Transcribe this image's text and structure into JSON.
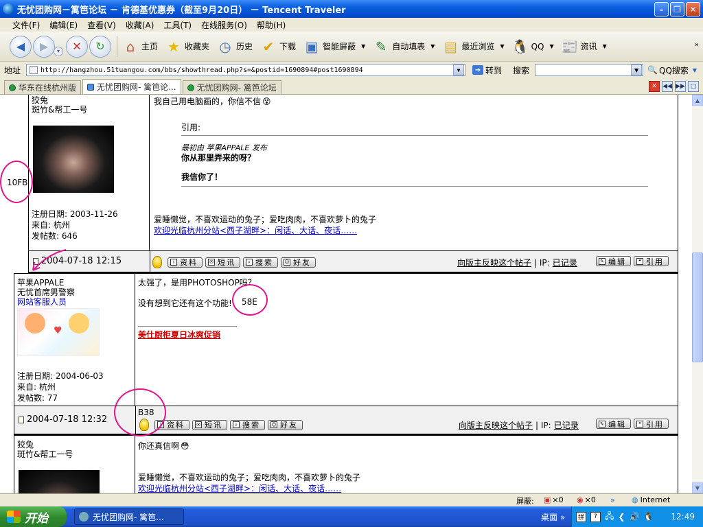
{
  "window": {
    "title": "无忧团购网－篱笆论坛 － 肯德基优惠券（截至9月20日） － Tencent Traveler"
  },
  "menu": [
    "文件(F)",
    "编辑(E)",
    "查看(V)",
    "收藏(A)",
    "工具(T)",
    "在线服务(O)",
    "帮助(H)"
  ],
  "toolbar": {
    "home": "主页",
    "favorites": "收藏夹",
    "history": "历史",
    "download": "下载",
    "block": "智能屏蔽",
    "autofill": "自动填表",
    "recent": "最近浏览",
    "qq": "QQ",
    "news": "资讯"
  },
  "address": {
    "label": "地址",
    "url": "http://hangzhou.51tuangou.com/bbs/showthread.php?s=&postid=1690894#post1690894",
    "go": "转到",
    "search_label": "搜索",
    "search_value": "",
    "qq_search": "QQ搜索"
  },
  "tabs": [
    {
      "label": "华东在线杭州版"
    },
    {
      "label": "无忧团购网- 篱笆论..."
    },
    {
      "label": "无忧团购网- 篱笆论坛"
    }
  ],
  "post1": {
    "username": "狡兔",
    "title": "斑竹&帮工一号",
    "reg_date": "注册日期: 2003-11-26",
    "from": "来自: 杭州",
    "posts": "发帖数: 646",
    "body_line1": "我自己用电脑画的，你信不信",
    "quote_label": "引用:",
    "quote_from": "最初由 苹果APPALE 发布",
    "quote_line1": "你从那里弄来的呀？",
    "quote_line2": "我信你了！",
    "signature": "爱睡懒觉，不喜欢运动的兔子；爱吃肉肉，不喜欢萝卜的兔子",
    "signature_link": "欢迎光临杭州分站<西子湖畔>：闲话、大话、夜话……",
    "date": "2004-07-18 12:15",
    "btn_profile": "资料",
    "btn_pm": "短讯",
    "btn_search": "搜索",
    "btn_friend": "好友",
    "report": "向版主反映这个帖子",
    "ip_label": "| IP:",
    "ip_link": "已记录",
    "btn_edit": "编辑",
    "btn_quote": "引用"
  },
  "post2": {
    "username": "苹果APPALE",
    "title": "无忧首席男警察",
    "role": "网站客服人员",
    "reg_date": "注册日期: 2004-06-03",
    "from": "来自: 杭州",
    "posts": "发帖数: 77",
    "body_line1": "太强了，是用PHOTOSHOP吗？",
    "body_line2": "没有想到它还有这个功能!",
    "signature_link": "美仕厨柜夏日冰爽促销",
    "date": "2004-07-18 12:32",
    "btn_profile": "资料",
    "btn_pm": "短讯",
    "btn_search": "搜索",
    "btn_friend": "好友",
    "report": "向版主反映这个帖子",
    "ip_label": "| IP:",
    "ip_link": "已记录",
    "btn_edit": "编辑",
    "btn_quote": "引用"
  },
  "post3": {
    "username": "狡兔",
    "title": "斑竹&帮工一号",
    "body_line1": "你还真信啊",
    "signature": "爱睡懒觉，不喜欢运动的兔子；爱吃肉肉，不喜欢萝卜的兔子",
    "signature_link": "欢迎光临杭州分站<西子湖畔>：闲话、大话、夜话……"
  },
  "annotations": {
    "a1": "10FB",
    "a2": "58E",
    "a3": "B38"
  },
  "status": {
    "block_label": "屏蔽:",
    "count1": "×0",
    "count2": "×0",
    "zone": "Internet"
  },
  "taskbar": {
    "start": "开始",
    "task": "无忧团购网- 篱笆...",
    "desktop": "桌面",
    "clock": "12:49"
  },
  "colors": {
    "annotation": "#e0148c",
    "link": "#0000cc",
    "promo": "#cc0000"
  }
}
